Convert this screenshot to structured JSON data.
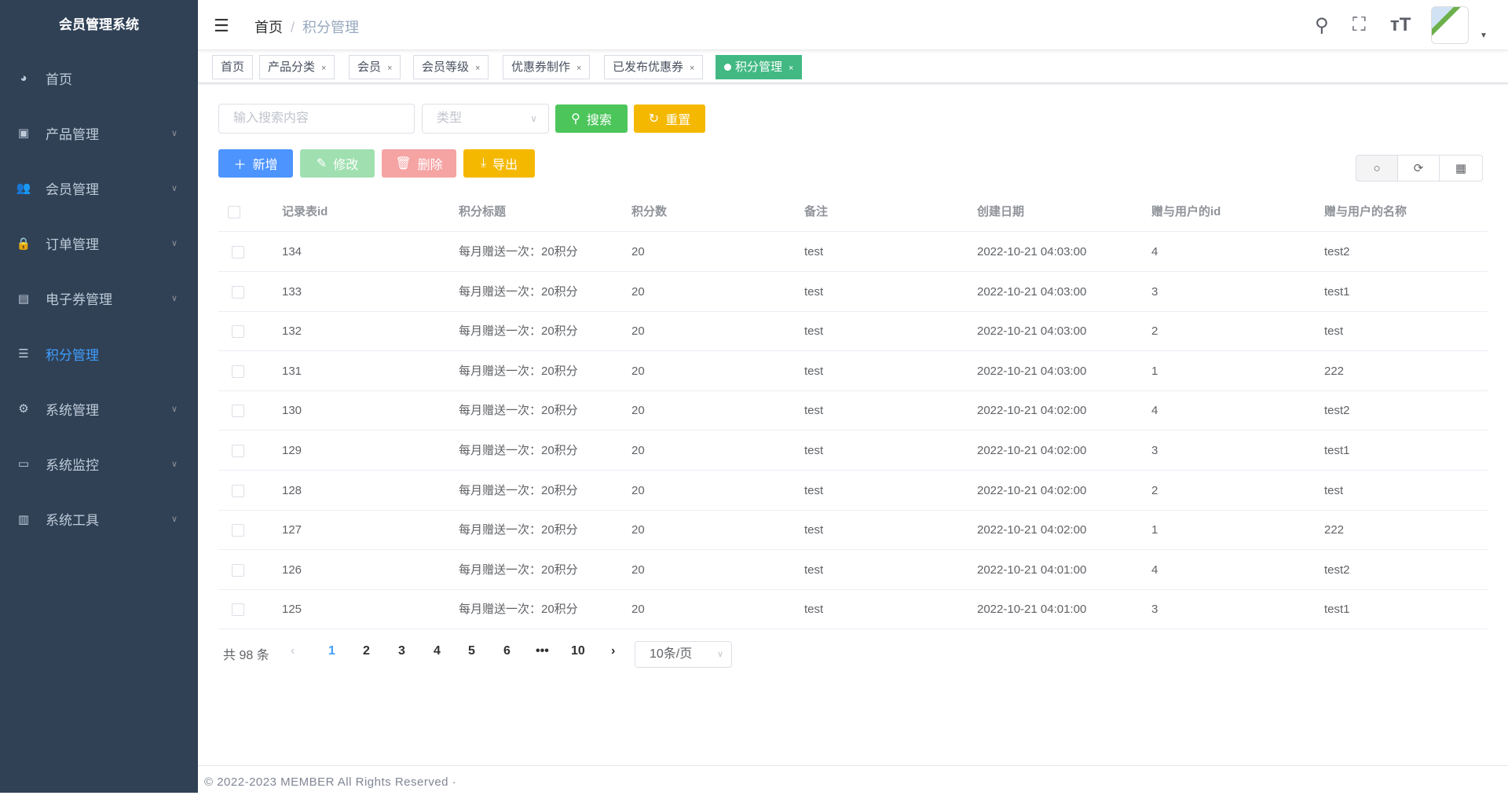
{
  "sidebar": {
    "title": "会员管理系统",
    "items": [
      {
        "label": "首页",
        "icon": "dashboard-icon",
        "glyph": "◕",
        "chev": false
      },
      {
        "label": "产品管理",
        "icon": "product-icon",
        "glyph": "▣",
        "chev": true
      },
      {
        "label": "会员管理",
        "icon": "users-icon",
        "glyph": "👥",
        "chev": true
      },
      {
        "label": "订单管理",
        "icon": "lock-icon",
        "glyph": "🔒",
        "chev": true
      },
      {
        "label": "电子券管理",
        "icon": "coupon-icon",
        "glyph": "▤",
        "chev": true
      },
      {
        "label": "积分管理",
        "icon": "database-icon",
        "glyph": "☰",
        "chev": false,
        "active": true
      },
      {
        "label": "系统管理",
        "icon": "gear-icon",
        "glyph": "⚙",
        "chev": true
      },
      {
        "label": "系统监控",
        "icon": "monitor-icon",
        "glyph": "▭",
        "chev": true
      },
      {
        "label": "系统工具",
        "icon": "toolbox-icon",
        "glyph": "▥",
        "chev": true
      }
    ]
  },
  "header": {
    "breadcrumb": [
      "首页",
      "积分管理"
    ]
  },
  "tags": [
    {
      "label": "首页"
    },
    {
      "label": "产品分类"
    },
    {
      "label": "会员"
    },
    {
      "label": "会员等级"
    },
    {
      "label": "优惠券制作"
    },
    {
      "label": "已发布优惠券"
    },
    {
      "label": "积分管理",
      "active": true
    }
  ],
  "search": {
    "placeholder": "输入搜索内容",
    "type_placeholder": "类型",
    "search_label": "搜索",
    "reset_label": "重置"
  },
  "toolbar": {
    "add": "新增",
    "edit": "修改",
    "delete": "删除",
    "export": "导出"
  },
  "colors": {
    "sidebar": "#304156",
    "active": "#409eff",
    "green": "#42b983"
  },
  "table": {
    "columns": [
      "记录表id",
      "积分标题",
      "积分数",
      "备注",
      "创建日期",
      "赠与用户的id",
      "赠与用户的名称"
    ],
    "rows": [
      [
        "134",
        "每月赠送一次：20积分",
        "20",
        "test",
        "2022-10-21 04:03:00",
        "4",
        "test2"
      ],
      [
        "133",
        "每月赠送一次：20积分",
        "20",
        "test",
        "2022-10-21 04:03:00",
        "3",
        "test1"
      ],
      [
        "132",
        "每月赠送一次：20积分",
        "20",
        "test",
        "2022-10-21 04:03:00",
        "2",
        "test"
      ],
      [
        "131",
        "每月赠送一次：20积分",
        "20",
        "test",
        "2022-10-21 04:03:00",
        "1",
        "222"
      ],
      [
        "130",
        "每月赠送一次：20积分",
        "20",
        "test",
        "2022-10-21 04:02:00",
        "4",
        "test2"
      ],
      [
        "129",
        "每月赠送一次：20积分",
        "20",
        "test",
        "2022-10-21 04:02:00",
        "3",
        "test1"
      ],
      [
        "128",
        "每月赠送一次：20积分",
        "20",
        "test",
        "2022-10-21 04:02:00",
        "2",
        "test"
      ],
      [
        "127",
        "每月赠送一次：20积分",
        "20",
        "test",
        "2022-10-21 04:02:00",
        "1",
        "222"
      ],
      [
        "126",
        "每月赠送一次：20积分",
        "20",
        "test",
        "2022-10-21 04:01:00",
        "4",
        "test2"
      ],
      [
        "125",
        "每月赠送一次：20积分",
        "20",
        "test",
        "2022-10-21 04:01:00",
        "3",
        "test1"
      ]
    ]
  },
  "pagination": {
    "total": "共 98 条",
    "pages": [
      "1",
      "2",
      "3",
      "4",
      "5",
      "6",
      "•••",
      "10"
    ],
    "page_size": "10条/页"
  },
  "footer": "© 2022-2023 MEMBER All Rights Reserved ·"
}
